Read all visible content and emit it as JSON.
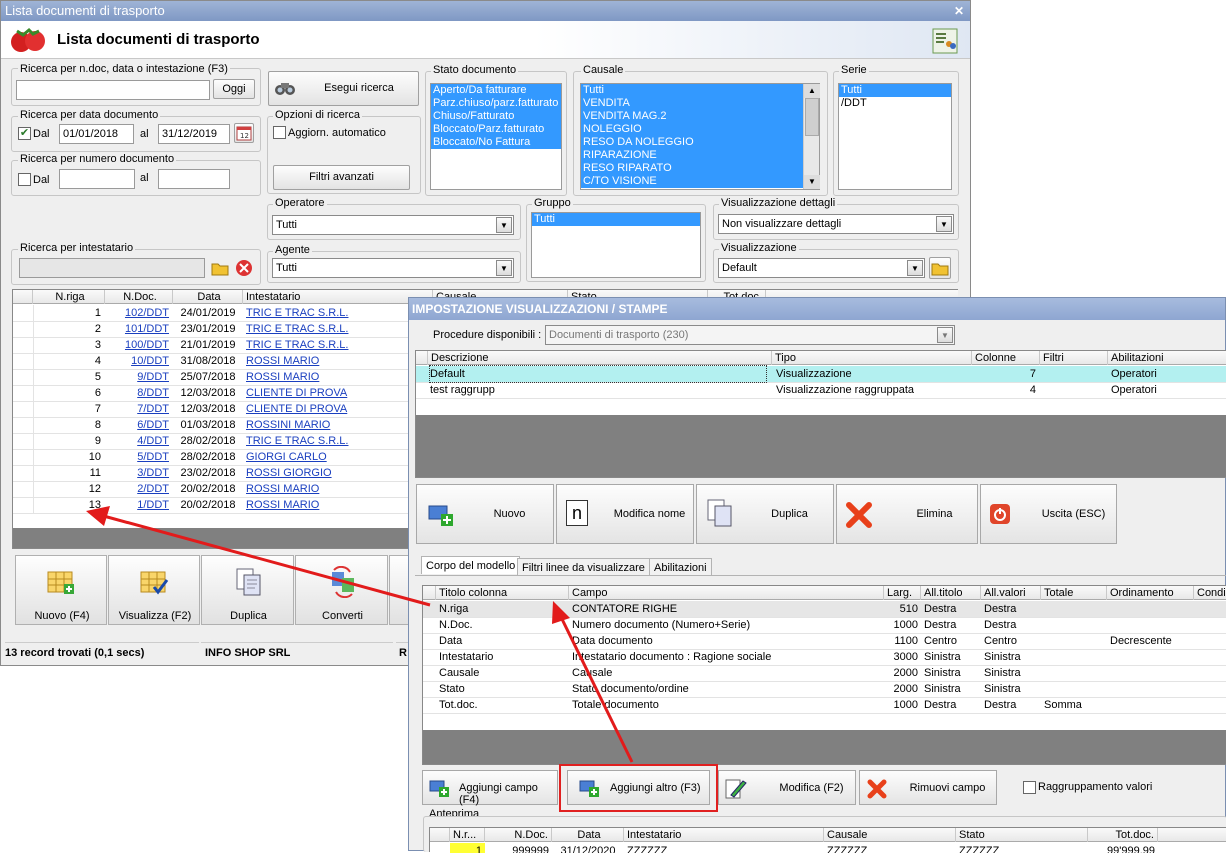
{
  "main": {
    "title": "Lista documenti di trasporto",
    "header": "Lista documenti di trasporto",
    "search_text_label": "Ricerca per n.doc, data o intestazione (F3)",
    "oggi_button": "Oggi",
    "esegui_button": "Esegui ricerca",
    "date_group_label": "Ricerca per data documento",
    "date_dal_label": "Dal",
    "date_from": "01/01/2018",
    "date_al_label": "al",
    "date_to": "31/12/2019",
    "numero_group_label": "Ricerca per numero documento",
    "numero_dal_label": "Dal",
    "numero_al_label": "al",
    "opzioni_label": "Opzioni di ricerca",
    "aggiorn_label": "Aggiorn. automatico",
    "filtri_button": "Filtri avanzati",
    "stato_label": "Stato documento",
    "stato_items": [
      "Aperto/Da fatturare",
      "Parz.chiuso/parz.fatturato",
      "Chiuso/Fatturato",
      "Bloccato/Parz.fatturato",
      "Bloccato/No Fattura"
    ],
    "causale_label": "Causale",
    "causale_items": [
      "Tutti",
      "VENDITA",
      "VENDITA MAG.2",
      "NOLEGGIO",
      "RESO DA NOLEGGIO",
      "RIPARAZIONE",
      "RESO RIPARATO",
      "C/TO VISIONE"
    ],
    "serie_label": "Serie",
    "serie_items": [
      "Tutti",
      "/DDT"
    ],
    "operatore_label": "Operatore",
    "operatore_value": "Tutti",
    "gruppo_label": "Gruppo",
    "gruppo_items": [
      "Tutti"
    ],
    "visdettagli_label": "Visualizzazione dettagli",
    "visdettagli_value": "Non visualizzare dettagli",
    "intestatario_label": "Ricerca per intestatario",
    "agente_label": "Agente",
    "agente_value": "Tutti",
    "visualizzazione_label": "Visualizzazione",
    "visualizzazione_value": "Default",
    "grid_headers": [
      "N.riga",
      "N.Doc.",
      "Data",
      "Intestatario",
      "Causale",
      "Stato",
      "Tot.doc."
    ],
    "rows": [
      {
        "n": "1",
        "doc": "102/DDT",
        "data": "24/01/2019",
        "int": "TRIC E TRAC S.R.L."
      },
      {
        "n": "2",
        "doc": "101/DDT",
        "data": "23/01/2019",
        "int": "TRIC E TRAC S.R.L."
      },
      {
        "n": "3",
        "doc": "100/DDT",
        "data": "21/01/2019",
        "int": "TRIC E TRAC S.R.L."
      },
      {
        "n": "4",
        "doc": "10/DDT",
        "data": "31/08/2018",
        "int": "ROSSI MARIO"
      },
      {
        "n": "5",
        "doc": "9/DDT",
        "data": "25/07/2018",
        "int": "ROSSI MARIO"
      },
      {
        "n": "6",
        "doc": "8/DDT",
        "data": "12/03/2018",
        "int": "CLIENTE DI PROVA"
      },
      {
        "n": "7",
        "doc": "7/DDT",
        "data": "12/03/2018",
        "int": "CLIENTE DI PROVA"
      },
      {
        "n": "8",
        "doc": "6/DDT",
        "data": "01/03/2018",
        "int": "ROSSINI MARIO"
      },
      {
        "n": "9",
        "doc": "4/DDT",
        "data": "28/02/2018",
        "int": "TRIC E TRAC S.R.L."
      },
      {
        "n": "10",
        "doc": "5/DDT",
        "data": "28/02/2018",
        "int": "GIORGI CARLO"
      },
      {
        "n": "11",
        "doc": "3/DDT",
        "data": "23/02/2018",
        "int": "ROSSI GIORGIO"
      },
      {
        "n": "12",
        "doc": "2/DDT",
        "data": "20/02/2018",
        "int": "ROSSI MARIO"
      },
      {
        "n": "13",
        "doc": "1/DDT",
        "data": "20/02/2018",
        "int": "ROSSI MARIO"
      }
    ],
    "buttons": [
      "Nuovo (F4)",
      "Visualizza (F2)",
      "Duplica",
      "Converti"
    ],
    "status_records": "13 record trovati (0,1 secs)",
    "status_company": "INFO SHOP SRL",
    "status_extra": "R"
  },
  "dialog": {
    "title": "IMPOSTAZIONE VISUALIZZAZIONI / STAMPE",
    "procedure_label": "Procedure disponibili :",
    "procedure_value": "Documenti di trasporto (230)",
    "headers": [
      "Descrizione",
      "Tipo",
      "Colonne",
      "Filtri",
      "Abilitazioni"
    ],
    "rows": [
      {
        "desc": "Default",
        "tipo": "Visualizzazione",
        "col": "7",
        "filtri": "",
        "abil": "Operatori"
      },
      {
        "desc": "test raggrupp",
        "tipo": "Visualizzazione raggruppata",
        "col": "4",
        "filtri": "",
        "abil": "Operatori"
      }
    ],
    "buttons": [
      "Nuovo",
      "Modifica nome",
      "Duplica",
      "Elimina",
      "Uscita (ESC)"
    ],
    "tabs": [
      "Corpo del modello",
      "Filtri linee da visualizzare",
      "Abilitazioni"
    ],
    "col_headers": [
      "Titolo colonna",
      "Campo",
      "Larg.",
      "All.titolo",
      "All.valori",
      "Totale",
      "Ordinamento",
      "Condi"
    ],
    "col_rows": [
      {
        "t": "N.riga",
        "c": "CONTATORE RIGHE",
        "l": "510",
        "at": "Destra",
        "av": "Destra",
        "tot": "",
        "ord": ""
      },
      {
        "t": "N.Doc.",
        "c": "Numero documento (Numero+Serie)",
        "l": "1000",
        "at": "Destra",
        "av": "Destra",
        "tot": "",
        "ord": ""
      },
      {
        "t": "Data",
        "c": "Data documento",
        "l": "1100",
        "at": "Centro",
        "av": "Centro",
        "tot": "",
        "ord": "Decrescente"
      },
      {
        "t": "Intestatario",
        "c": "Intestatario documento : Ragione sociale",
        "l": "3000",
        "at": "Sinistra",
        "av": "Sinistra",
        "tot": "",
        "ord": ""
      },
      {
        "t": "Causale",
        "c": "Causale",
        "l": "2000",
        "at": "Sinistra",
        "av": "Sinistra",
        "tot": "",
        "ord": ""
      },
      {
        "t": "Stato",
        "c": "Stato documento/ordine",
        "l": "2000",
        "at": "Sinistra",
        "av": "Sinistra",
        "tot": "",
        "ord": ""
      },
      {
        "t": "Tot.doc.",
        "c": "Totale documento",
        "l": "1000",
        "at": "Destra",
        "av": "Destra",
        "tot": "Somma",
        "ord": ""
      }
    ],
    "field_buttons": [
      "Aggiungi campo (F4)",
      "Aggiungi altro (F3)",
      "Modifica (F2)",
      "Rimuovi campo"
    ],
    "raggruppamento_label": "Raggruppamento valori",
    "anteprima_label": "Anteprima",
    "preview_headers": [
      "N.r...",
      "N.Doc.",
      "Data",
      "Intestatario",
      "Causale",
      "Stato",
      "Tot.doc."
    ],
    "preview_row": [
      "1",
      "999999",
      "31/12/2020",
      "ZZZZZZ",
      "ZZZZZZ",
      "ZZZZZZ",
      "99'999,99"
    ]
  }
}
